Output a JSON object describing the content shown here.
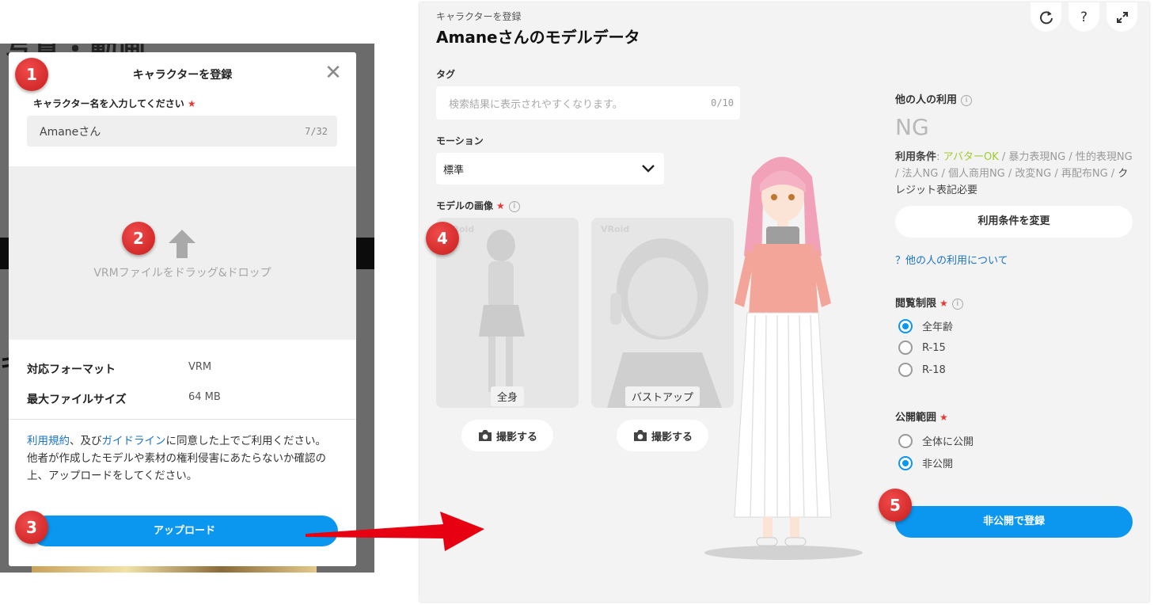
{
  "background_page": {
    "title_fragment": "写真・動画",
    "chars_fragment": "キ"
  },
  "modal": {
    "title": "キャラクターを登録",
    "name_label": "キャラクター名を入力してください",
    "required_mark": "★",
    "name_value": "Amaneさん",
    "name_counter": "7/32",
    "dropzone_text": "VRMファイルをドラッグ&ドロップ",
    "format_label": "対応フォーマット",
    "format_value": "VRM",
    "maxsize_label": "最大ファイルサイズ",
    "maxsize_value": "64 MB",
    "terms_link": "利用規約",
    "terms_mid": "、及び",
    "guideline_link": "ガイドライン",
    "terms_rest": "に同意した上でご利用ください。",
    "terms_line2": "他者が作成したモデルや素材の権利侵害にあたらないか確認の上、アップロードをしてください。",
    "upload_button": "アップロード"
  },
  "panel": {
    "breadcrumb": "キャラクターを登録",
    "title": "Amaneさんのモデルデータ",
    "tag_label": "タグ",
    "tag_placeholder": "検索結果に表示されやすくなります。",
    "tag_counter": "0/10",
    "motion_label": "モーション",
    "motion_value": "標準",
    "images_label": "モデルの画像",
    "watermark": "VRoid",
    "thumb_full_caption": "全身",
    "thumb_bust_caption": "バストアップ",
    "shoot_label": "撮影する",
    "others_use_label": "他の人の利用",
    "others_use_value": "NG",
    "cond_label": "利用条件",
    "cond_avatar": "アバターOK",
    "cond_rest": " / 暴力表現NG / 性的表現NG / 法人NG / 個人商用NG / 改変NG / 再配布NG",
    "cond_credit": "クレジット表記必要",
    "change_terms_button": "利用条件を変更",
    "about_link": "？他の人の利用について",
    "view_restrict_label": "閲覧制限",
    "view_options": [
      "全年齢",
      "R-15",
      "R-18"
    ],
    "view_selected": "全年齢",
    "publish_label": "公開範囲",
    "publish_options": [
      "全体に公開",
      "非公開"
    ],
    "publish_selected": "非公開",
    "register_button": "非公開で登録"
  },
  "badges": [
    "1",
    "2",
    "3",
    "4",
    "5"
  ],
  "colors": {
    "primary": "#0b97f0",
    "required": "#e53935",
    "ok_green": "#9ccc2c",
    "badge_red": "#d42a2a"
  }
}
